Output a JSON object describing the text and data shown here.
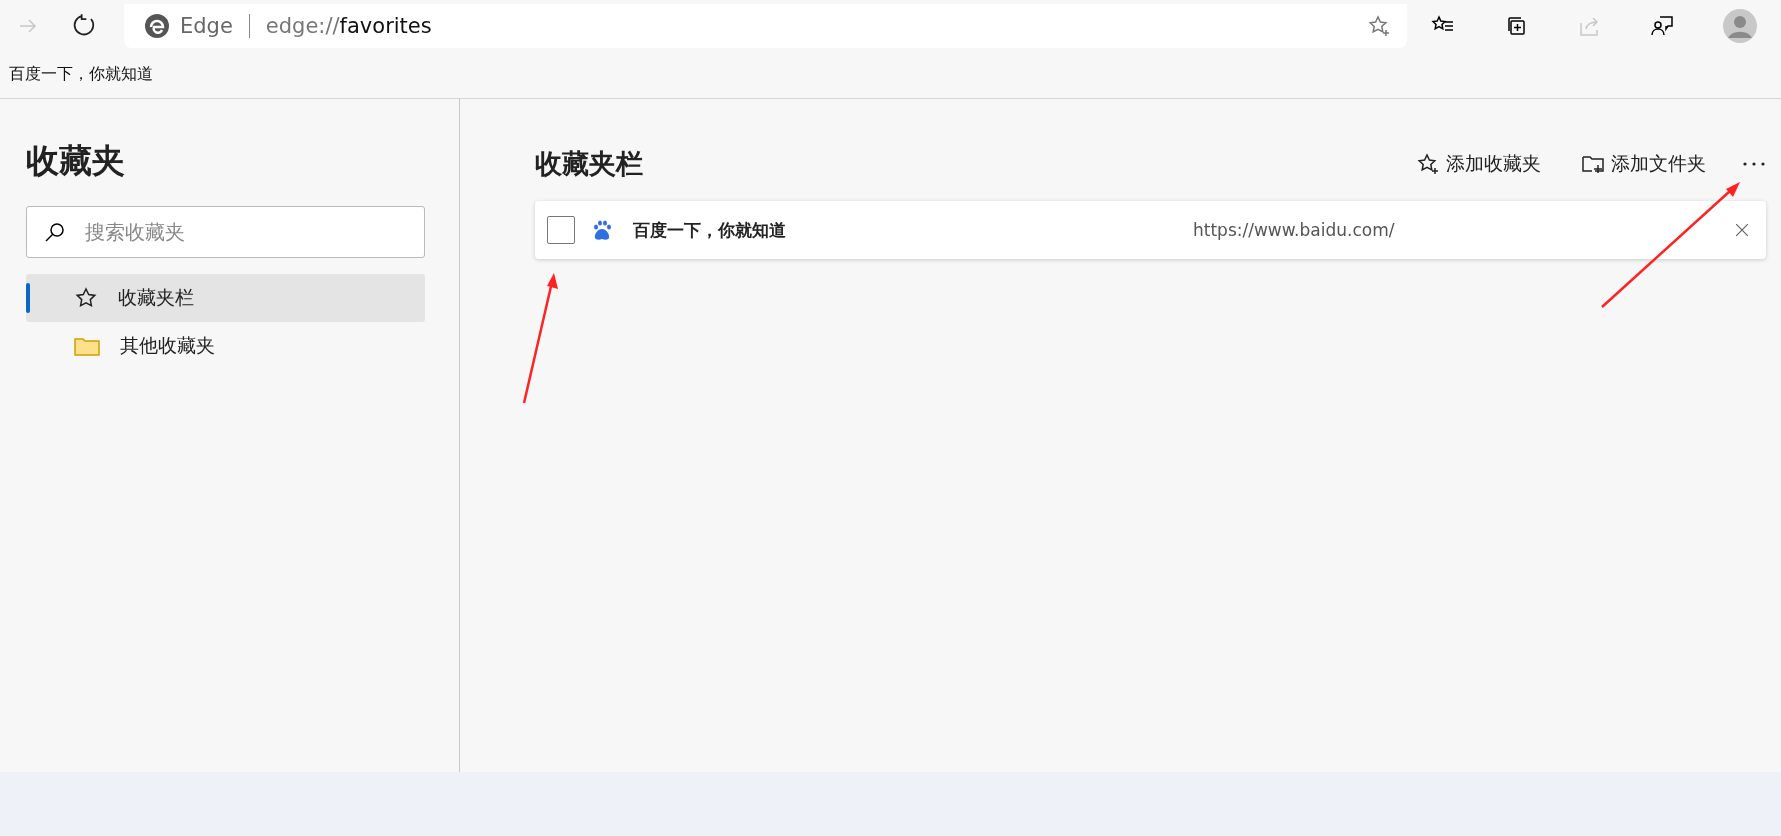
{
  "browser": {
    "brand": "Edge",
    "address_host": "edge://",
    "address_path": "favorites"
  },
  "bookmarks_bar": [
    "百度一下，你就知道"
  ],
  "sidebar": {
    "title": "收藏夹",
    "search": {
      "placeholder": "搜索收藏夹"
    },
    "items": [
      {
        "label": "收藏夹栏",
        "kind": "star",
        "selected": true
      },
      {
        "label": "其他收藏夹",
        "kind": "folder",
        "selected": false
      }
    ]
  },
  "main": {
    "title": "收藏夹栏",
    "actions": [
      {
        "label": "添加收藏夹",
        "kind": "star"
      },
      {
        "label": "添加文件夹",
        "kind": "folder"
      }
    ],
    "rows": [
      {
        "title": "百度一下，你就知道",
        "url": "https://www.baidu.com/",
        "checked": false
      }
    ]
  }
}
